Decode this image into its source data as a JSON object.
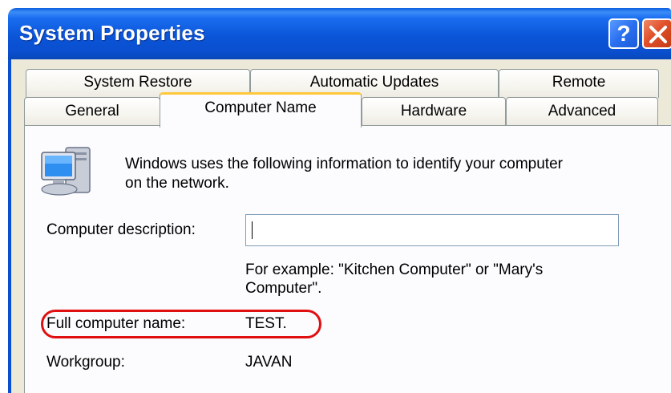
{
  "window": {
    "title": "System Properties",
    "help_label": "?",
    "icons": {
      "help": "help-icon",
      "close": "close-icon",
      "computer": "computer-icon"
    },
    "colors": {
      "titlebar": "#0a55d8",
      "client": "#ece9d8",
      "panel": "#fcfcfe",
      "active_tab_accent": "#ffc83c",
      "highlight": "#e01010"
    }
  },
  "tabs": {
    "row_back": [
      "System Restore",
      "Automatic Updates",
      "Remote"
    ],
    "row_front": [
      "General",
      "Computer Name",
      "Hardware",
      "Advanced"
    ],
    "selected": "Computer Name"
  },
  "panel": {
    "intro_line1": "Windows uses the following information to identify your computer",
    "intro_line2": "on the network.",
    "description_label": "Computer description:",
    "description_value": "",
    "example_line1": "For example: \"Kitchen Computer\" or \"Mary's",
    "example_line2": "Computer\".",
    "full_name_label": "Full computer name:",
    "full_name_value": "TEST.",
    "workgroup_label": "Workgroup:",
    "workgroup_value": "JAVAN"
  }
}
